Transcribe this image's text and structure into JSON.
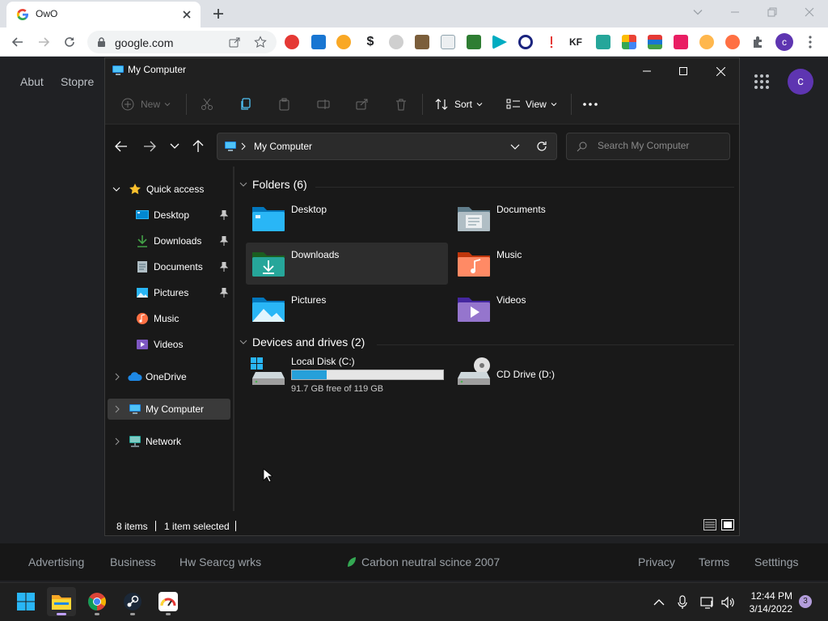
{
  "browser": {
    "tab_title": "OwO",
    "omnibox_url": "google.com",
    "profile_initial": "c"
  },
  "google": {
    "top_left_links": [
      "Abut",
      "Stopre"
    ],
    "account_initial": "c",
    "footer": {
      "left_links": [
        "Advertising",
        "Business",
        "Hw Searcg wrks"
      ],
      "carbon": "Carbon neutral scince 2007",
      "right_links": [
        "Privacy",
        "Terms",
        "Setttings"
      ]
    }
  },
  "explorer": {
    "window_title": "My Computer",
    "commands": {
      "new": "New",
      "sort": "Sort",
      "view": "View"
    },
    "address": "My Computer",
    "search_placeholder": "Search My Computer",
    "sidebar": {
      "quick_access": "Quick access",
      "pinned": [
        {
          "label": "Desktop",
          "pinned": true,
          "icon": "desktop-icon"
        },
        {
          "label": "Downloads",
          "pinned": true,
          "icon": "download-icon"
        },
        {
          "label": "Documents",
          "pinned": true,
          "icon": "document-icon"
        },
        {
          "label": "Pictures",
          "pinned": true,
          "icon": "picture-icon"
        },
        {
          "label": "Music",
          "pinned": false,
          "icon": "music-icon"
        },
        {
          "label": "Videos",
          "pinned": false,
          "icon": "video-icon"
        }
      ],
      "onedrive": "OneDrive",
      "my_computer": "My Computer",
      "network": "Network"
    },
    "folders_header": "Folders (6)",
    "folders": [
      {
        "label": "Desktop",
        "icon": "desktop-folder-icon",
        "selected": false
      },
      {
        "label": "Documents",
        "icon": "documents-folder-icon",
        "selected": false
      },
      {
        "label": "Downloads",
        "icon": "downloads-folder-icon",
        "selected": true
      },
      {
        "label": "Music",
        "icon": "music-folder-icon",
        "selected": false
      },
      {
        "label": "Pictures",
        "icon": "pictures-folder-icon",
        "selected": false
      },
      {
        "label": "Videos",
        "icon": "videos-folder-icon",
        "selected": false
      }
    ],
    "drives_header": "Devices and drives (2)",
    "drives": {
      "c_label": "Local Disk (C:)",
      "c_free": "91.7 GB free of 119 GB",
      "c_used_fraction": 0.23,
      "d_label": "CD Drive (D:)"
    },
    "status": {
      "items": "8 items",
      "selected": "1 item selected"
    }
  },
  "taskbar": {
    "time": "12:44 PM",
    "date": "3/14/2022",
    "notifications": "3"
  }
}
